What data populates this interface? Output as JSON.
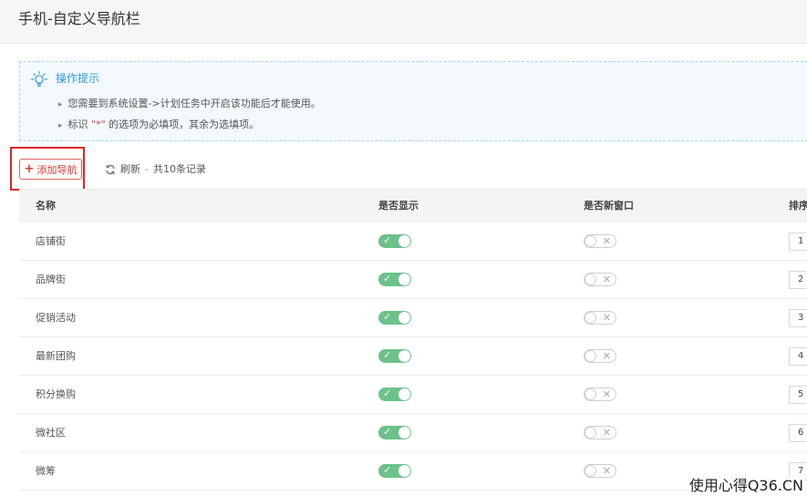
{
  "header": {
    "title": "手机-自定义导航栏"
  },
  "tips": {
    "title": "操作提示",
    "items": [
      {
        "text": "您需要到系统设置->计划任务中开启该功能后才能使用。"
      },
      {
        "before": "标识 ",
        "star": "\"*\"",
        "after": " 的选项为必填项，其余为选填项。"
      }
    ]
  },
  "toolbar": {
    "add_label": "添加导航",
    "refresh_label": "刷新",
    "separator": "-",
    "record_count": "共10条记录"
  },
  "table": {
    "columns": [
      "名称",
      "是否显示",
      "是否新窗口",
      "排序"
    ],
    "rows": [
      {
        "name": "店铺街",
        "show": true,
        "new_window": false,
        "sort": "1"
      },
      {
        "name": "品牌街",
        "show": true,
        "new_window": false,
        "sort": "2"
      },
      {
        "name": "促销活动",
        "show": true,
        "new_window": false,
        "sort": "3"
      },
      {
        "name": "最新团购",
        "show": true,
        "new_window": false,
        "sort": "4"
      },
      {
        "name": "积分换购",
        "show": true,
        "new_window": false,
        "sort": "5"
      },
      {
        "name": "微社区",
        "show": true,
        "new_window": false,
        "sort": "6"
      },
      {
        "name": "微筹",
        "show": true,
        "new_window": false,
        "sort": "7"
      }
    ]
  },
  "toggle_marks": {
    "on": "✓",
    "off": "✕"
  },
  "colors": {
    "accent": "#2e9bdc",
    "danger": "#e02424",
    "toggle_on": "#6cc28a"
  },
  "watermark": "使用心得Q36.CN"
}
